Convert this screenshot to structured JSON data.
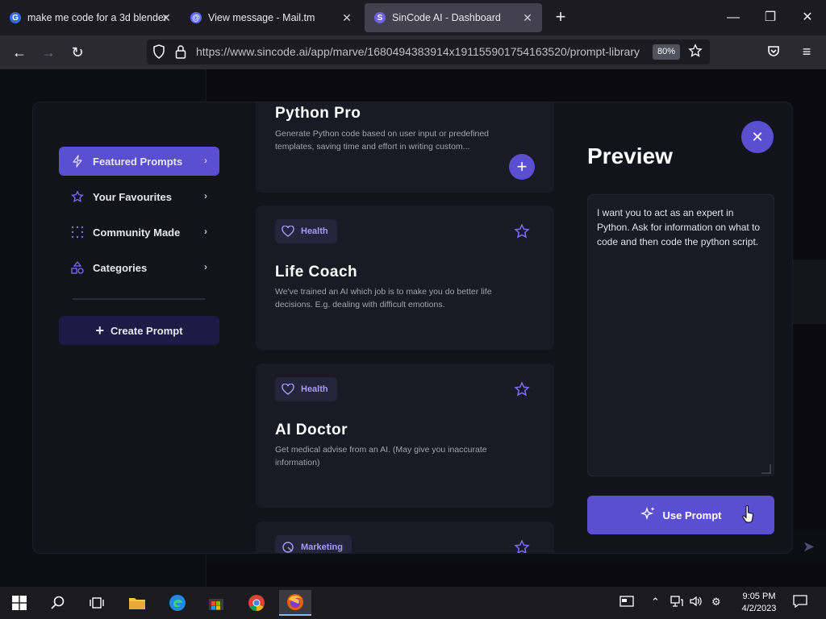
{
  "browser": {
    "tabs": [
      {
        "title": "make me code for a 3d blender",
        "favicon": "G",
        "active": false
      },
      {
        "title": "View message - Mail.tm",
        "favicon": "@",
        "active": false
      },
      {
        "title": "SinCode AI - Dashboard",
        "favicon": "S",
        "active": true
      }
    ],
    "url": "https://www.sincode.ai/app/marve/1680494383914x191155901754163520/prompt-library",
    "zoom": "80%"
  },
  "sidebar": {
    "items": [
      {
        "label": "Featured Prompts",
        "icon": "lightning-icon",
        "active": true
      },
      {
        "label": "Your Favourites",
        "icon": "star-icon",
        "active": false
      },
      {
        "label": "Community Made",
        "icon": "dots-grid-icon",
        "active": false
      },
      {
        "label": "Categories",
        "icon": "shapes-icon",
        "active": false
      }
    ],
    "create_label": "Create Prompt"
  },
  "cards": [
    {
      "title": "Python Pro",
      "description": "Generate Python code based on user input or predefined templates, saving time and effort in writing custom...",
      "tag": "",
      "action": "add"
    },
    {
      "title": "Life Coach",
      "description": "We've trained an AI which job is to make you do better life decisions. E.g. dealing with difficult emotions.",
      "tag": "Health",
      "action": "favourite"
    },
    {
      "title": "AI Doctor",
      "description": "Get medical advise from an AI. (May give you inaccurate information)",
      "tag": "Health",
      "action": "favourite"
    },
    {
      "title": "",
      "description": "",
      "tag": "Marketing",
      "action": "favourite"
    }
  ],
  "preview": {
    "title": "Preview",
    "text": "I want you to act as an expert in Python. Ask for information on what to code and then code the python script.",
    "use_label": "Use Prompt"
  },
  "taskbar": {
    "time": "9:05 PM",
    "date": "4/2/2023"
  },
  "colors": {
    "accent": "#5b4fd1",
    "card_bg": "#1a1a25",
    "modal_bg": "#13131c"
  }
}
